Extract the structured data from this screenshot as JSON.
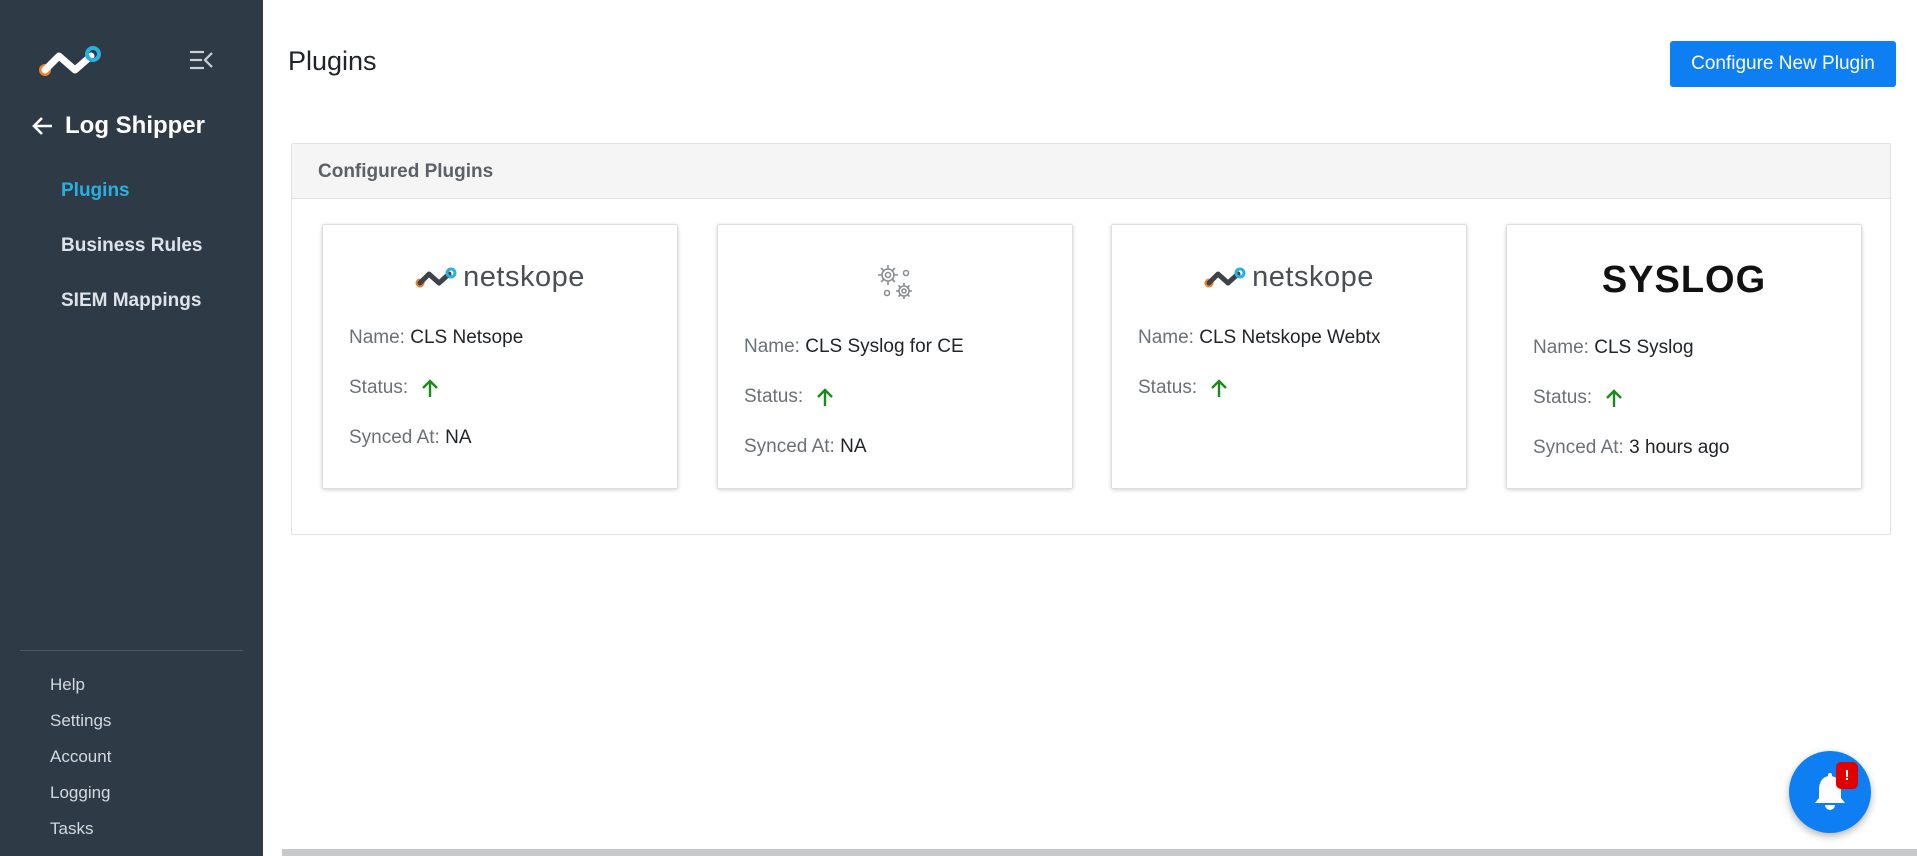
{
  "sidebar": {
    "logo_icon": "netskope-logo-icon",
    "collapse_icon": "collapse-menu-icon",
    "back_icon": "arrow-left-icon",
    "title": "Log Shipper",
    "nav_items": [
      {
        "label": "Plugins",
        "active": true
      },
      {
        "label": "Business Rules",
        "active": false
      },
      {
        "label": "SIEM Mappings",
        "active": false
      }
    ],
    "bottom_links": [
      "Help",
      "Settings",
      "Account",
      "Logging",
      "Tasks"
    ]
  },
  "header": {
    "title": "Plugins",
    "configure_button": "Configure New Plugin"
  },
  "panel": {
    "title": "Configured Plugins",
    "cards": [
      {
        "logo": "netskope-logo",
        "logo_text": "netskope",
        "name_label": "Name:",
        "name": "CLS Netsope",
        "status_label": "Status:",
        "status_icon": "arrow-up-icon",
        "synced_label": "Synced At:",
        "synced": "NA"
      },
      {
        "logo": "gears-icon",
        "name_label": "Name:",
        "name": "CLS Syslog for CE",
        "status_label": "Status:",
        "status_icon": "arrow-up-icon",
        "synced_label": "Synced At:",
        "synced": "NA"
      },
      {
        "logo": "netskope-logo",
        "logo_text": "netskope",
        "name_label": "Name:",
        "name": "CLS Netskope Webtx",
        "status_label": "Status:",
        "status_icon": "arrow-up-icon"
      },
      {
        "logo": "syslog-logo",
        "logo_text": "SYSLOG",
        "name_label": "Name:",
        "name": "CLS Syslog",
        "status_label": "Status:",
        "status_icon": "arrow-up-icon",
        "synced_label": "Synced At:",
        "synced": "3 hours ago"
      }
    ]
  },
  "notifications": {
    "icon": "bell-icon",
    "badge": "!"
  },
  "colors": {
    "sidebar_bg": "#2e3b47",
    "accent": "#0d7ff2",
    "active_nav": "#27b0e0",
    "status_up": "#1a8a1a",
    "badge": "#e00000"
  }
}
